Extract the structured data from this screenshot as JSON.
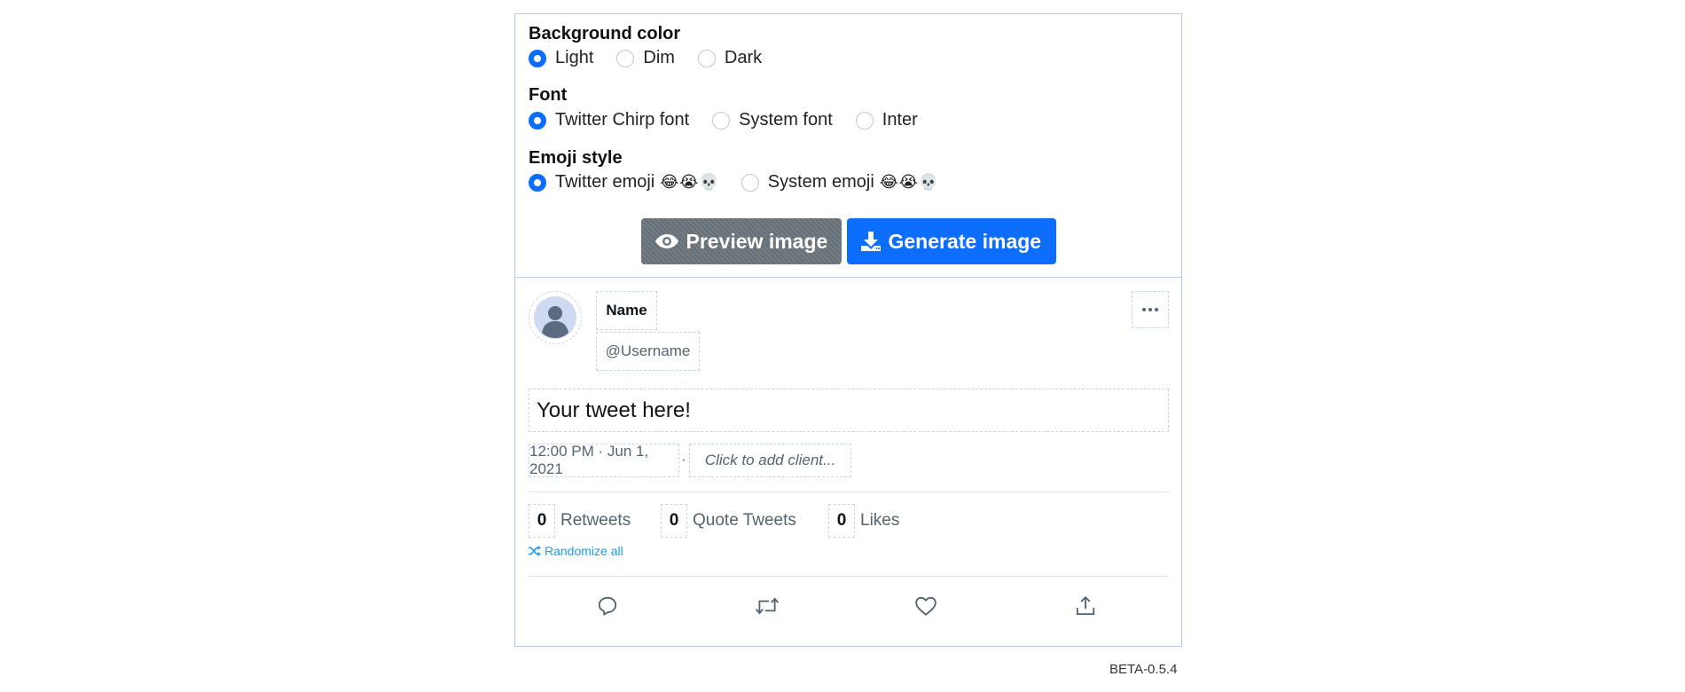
{
  "settings": {
    "background": {
      "title": "Background color",
      "options": [
        "Light",
        "Dim",
        "Dark"
      ],
      "selected": "Light"
    },
    "font": {
      "title": "Font",
      "options": [
        "Twitter Chirp font",
        "System font",
        "Inter"
      ],
      "selected": "Twitter Chirp font"
    },
    "emoji": {
      "title": "Emoji style",
      "options": [
        "Twitter emoji",
        "System emoji"
      ],
      "sample_twitter": "😂😭💀",
      "sample_system": "😂😭💀",
      "selected": "Twitter emoji"
    },
    "buttons": {
      "preview": "Preview image",
      "generate": "Generate image"
    }
  },
  "tweet": {
    "name": "Name",
    "username": "@Username",
    "text": "Your tweet here!",
    "time": "12:00 PM · Jun 1, 2021",
    "separator": "·",
    "client_placeholder": "Click to add client...",
    "stats": {
      "retweets_count": "0",
      "retweets_label": "Retweets",
      "quotes_count": "0",
      "quotes_label": "Quote Tweets",
      "likes_count": "0",
      "likes_label": "Likes"
    },
    "randomize": "Randomize all"
  },
  "version": "BETA-0.5.4",
  "colors": {
    "accent": "#0d6efd",
    "secondary": "#6c757d",
    "twitter_blue": "#1d9bf0",
    "muted": "#536471",
    "border": "#b9c9ef"
  },
  "icons": {
    "preview": "eye-icon",
    "generate": "download-icon",
    "more": "more-horizontal-icon",
    "randomize": "shuffle-icon",
    "reply": "reply-icon",
    "retweet": "retweet-icon",
    "like": "heart-icon",
    "share": "share-icon",
    "avatar": "default-avatar-icon"
  }
}
